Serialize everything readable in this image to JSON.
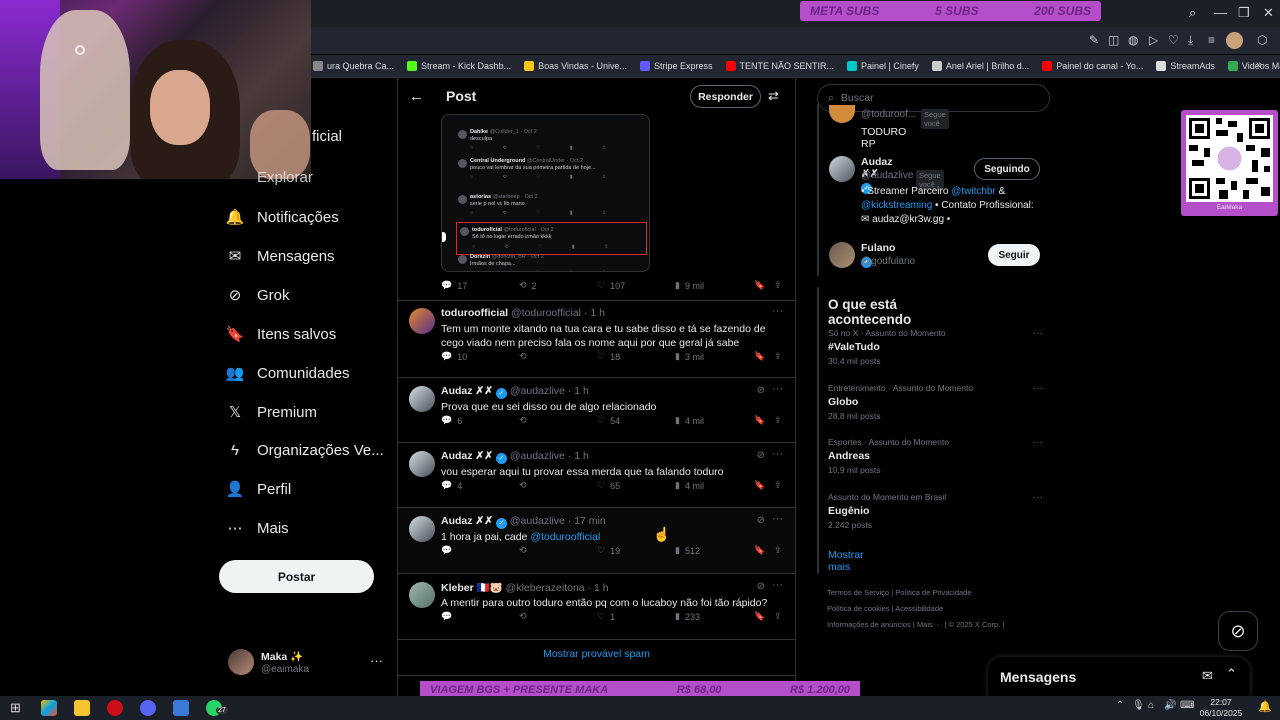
{
  "browser": {
    "sub_goal": {
      "label": "META SUBS",
      "current": "5 SUBS",
      "target": "200 SUBS",
      "progress": 0.025
    },
    "bookmarks": [
      {
        "label": "ura Quebra Ca...",
        "color": "#888"
      },
      {
        "label": "Stream - Kick Dashb...",
        "color": "#53fc18"
      },
      {
        "label": "Boas Vindas - Unive...",
        "color": "#f5c518"
      },
      {
        "label": "Stripe Express",
        "color": "#635bff"
      },
      {
        "label": "TENTE NÃO SENTIR...",
        "color": "#ff0000"
      },
      {
        "label": "Painel | Cinefy",
        "color": "#00c8c8"
      },
      {
        "label": "Anel Ariel | Brilho d...",
        "color": "#cccccc"
      },
      {
        "label": "Painel do canal - Yo...",
        "color": "#ff0000"
      },
      {
        "label": "StreamAds",
        "color": "#dddddd"
      },
      {
        "label": "Videos Maka - Goo...",
        "color": "#34a853"
      }
    ]
  },
  "nav": {
    "partial_top": "ficial",
    "partial_explore": "Explorar",
    "items": [
      {
        "label": "Notificações",
        "icon": "bell-icon",
        "glyph": "🔔"
      },
      {
        "label": "Mensagens",
        "icon": "mail-icon",
        "glyph": "✉"
      },
      {
        "label": "Grok",
        "icon": "grok-icon",
        "glyph": "⊘"
      },
      {
        "label": "Itens salvos",
        "icon": "bookmark-icon",
        "glyph": "🔖"
      },
      {
        "label": "Comunidades",
        "icon": "communities-icon",
        "glyph": "👥"
      },
      {
        "label": "Premium",
        "icon": "x-logo-icon",
        "glyph": "𝕏"
      },
      {
        "label": "Organizações Ve...",
        "icon": "lightning-icon",
        "glyph": "ϟ"
      },
      {
        "label": "Perfil",
        "icon": "person-icon",
        "glyph": "👤"
      },
      {
        "label": "Mais",
        "icon": "more-circle-icon",
        "glyph": "⋯"
      }
    ],
    "post_button": "Postar",
    "profile": {
      "name": "Maka ✨",
      "handle": "@eaimaka"
    }
  },
  "post": {
    "title": "Post",
    "reply_button": "Responder",
    "embed_actions": {
      "replies": "17",
      "reposts": "2",
      "likes": "107",
      "views": "9 mil"
    },
    "embed_lines": [
      {
        "name": "Dahlke",
        "handle": "@Cullder_1 · Oct 2",
        "text": "desculpa"
      },
      {
        "name": "Central Underground",
        "handle": "@CentralUnder · Oct 2",
        "text": "pouco vai lembrar da sua primeira partida de hoje..."
      },
      {
        "name": "astorias",
        "handle": "@starbeep · Oct 2",
        "text": "serie p nol vc lib mano"
      },
      {
        "name": "toduroficial",
        "handle": "@toduroficial · Oct 2",
        "text": "Só tô no lugar errado irmão kkkk"
      },
      {
        "name": "Dorkzin",
        "handle": "@dorkzin_BR · Oct 2",
        "text": "Irmãos de chapa..."
      }
    ]
  },
  "replies": [
    {
      "name": "toduroofficial",
      "handle": "@toduroofficial · 1 h",
      "verified": false,
      "text": "Tem um monte xitando na tua cara e tu sabe disso e tá se fazendo de cego viado nem preciso fala os nome aqui por que geral já sabe",
      "replies": "10",
      "reposts": "",
      "likes": "18",
      "views": "3 mil"
    },
    {
      "name": "Audaz ✗✗",
      "handle": "@audazlive · 1 h",
      "verified": true,
      "text": "Prova que eu sei disso ou de algo relacionado",
      "replies": "6",
      "reposts": "",
      "likes": "54",
      "views": "4 mil"
    },
    {
      "name": "Audaz ✗✗",
      "handle": "@audazlive · 1 h",
      "verified": true,
      "text": "vou esperar aqui tu provar essa merda que ta falando toduro",
      "replies": "4",
      "reposts": "",
      "likes": "65",
      "views": "4 mil"
    },
    {
      "name": "Audaz ✗✗",
      "handle": "@audazlive · 17 min",
      "verified": true,
      "text_prefix": "1 hora ja pai, cade ",
      "mention": "@toduroofficial",
      "replies": "",
      "reposts": "",
      "likes": "19",
      "views": "512"
    },
    {
      "name": "Kleber 🇫🇷🐷",
      "handle": "@kleberazeitona · 1 h",
      "verified": false,
      "text": "A mentir para outro toduro então pq com o lucaboy não foi tão rápido?",
      "replies": "",
      "reposts": "",
      "likes": "1",
      "views": "233"
    }
  ],
  "spam_link": "Mostrar provável spam",
  "sidebar": {
    "search_placeholder": "Buscar",
    "who_to_follow": [
      {
        "name": "TODURO RP",
        "handle": "@toduroof...",
        "badge": "Segue você",
        "button": ""
      },
      {
        "name": "Audaz ✗✗",
        "handle": "@audazlive",
        "badge": "Segue você",
        "button": "Seguindo",
        "bio_1": "• Streamer Parceiro ",
        "bio_link1": "@twitchbr",
        "bio_2": " & ",
        "bio_link2": "@kickstreaming",
        "bio_3": " • Contato Profissional: ✉ audaz@kr3w.gg •"
      },
      {
        "name": "Fulano",
        "handle": "@godfulano",
        "button": "Seguir"
      }
    ],
    "trends_title": "O que está acontecendo",
    "trends": [
      {
        "category": "Só no X · Assunto do Momento",
        "title": "#ValeTudo",
        "count": "30,4 mil posts"
      },
      {
        "category": "Entretenimento · Assunto do Momento",
        "title": "Globo",
        "count": "28,8 mil posts"
      },
      {
        "category": "Esportes · Assunto do Momento",
        "title": "Andreas",
        "count": "10,9 mil posts"
      },
      {
        "category": "Assunto do Momento em Brasil",
        "title": "Eugênio",
        "count": "2.242 posts"
      }
    ],
    "show_more": "Mostrar mais",
    "footer": [
      "Termos de Serviço",
      "Política de Privacidade",
      "Política de cookies",
      "Acessibilidade",
      "Informações de anúncios",
      "Mais ···",
      "© 2025 X Corp."
    ]
  },
  "qr_label": "EaiMaka",
  "messages_drawer": "Mensagens",
  "bottom_goal": {
    "label": "VIAGEM BGS + PRESENTE MAKA",
    "current": "R$ 68,00",
    "target": "R$ 1.200,00",
    "progress": 0.057
  },
  "taskbar": {
    "time": "22:07",
    "date": "06/10/2025",
    "whatsapp_badge": "27"
  }
}
